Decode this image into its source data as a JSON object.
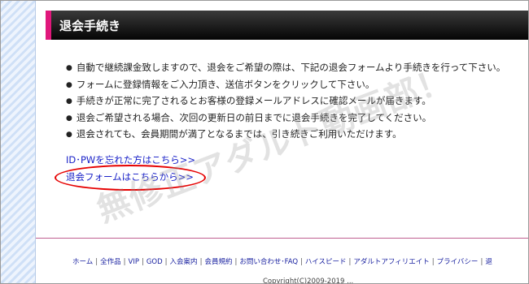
{
  "page_title": "退会手続き",
  "notes": [
    "自動で継続課金致しますので、退会をご希望の際は、下記の退会フォームより手続きを行って下さい。",
    "フォームに登録情報をご入力頂き、送信ボタンをクリックして下さい。",
    "手続きが正常に完了されるとお客様の登録メールアドレスに確認メールが届きます。",
    "退会ご希望される場合、次回の更新日の前日までに退会手続きを完了してください。",
    "退会されても、会員期間が満了となるまでは、引き続きご利用いただけます。"
  ],
  "links": {
    "forgot_id_pw": "ID･PWを忘れた方はこちら>>",
    "withdraw_form": "退会フォームはこちらから>>"
  },
  "footer": {
    "nav": [
      "ホーム",
      "全作品",
      "VIP",
      "GOD",
      "入会案内",
      "会員規約",
      "お問い合わせ･FAQ",
      "ハイスピード",
      "アダルトアフィリエイト",
      "プライバシー",
      "退"
    ],
    "separator": "|",
    "copyright": "Copyright(C)2009-2019 ..."
  },
  "watermark": "無修正アダルト動画部！",
  "colors": {
    "title_accent": "#e0177b",
    "link": "#1a22c8",
    "highlight_oval": "#e60000"
  }
}
